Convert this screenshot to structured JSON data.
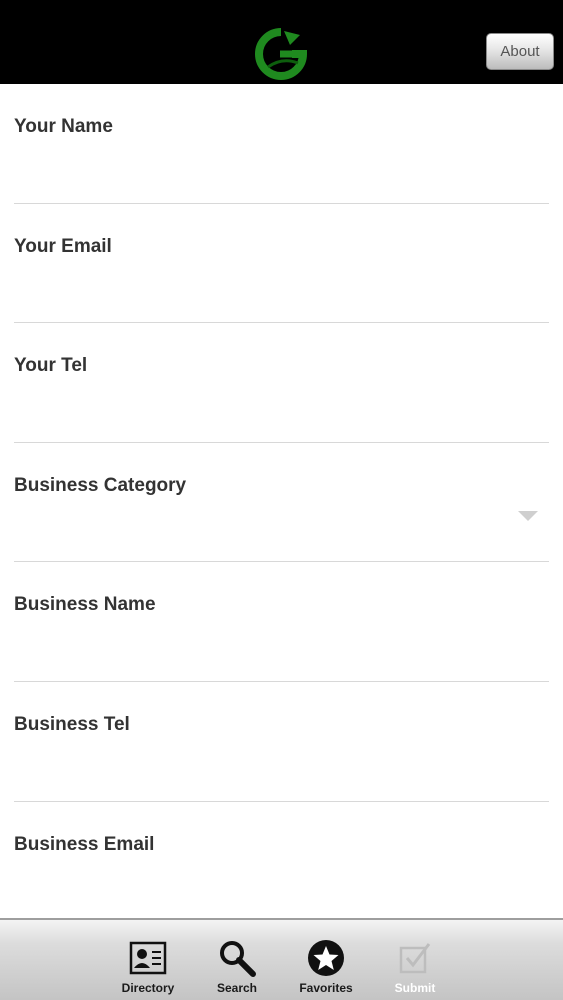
{
  "header": {
    "about_label": "About"
  },
  "form": {
    "fields": [
      {
        "label": "Your Name",
        "value": "",
        "type": "text"
      },
      {
        "label": "Your Email",
        "value": "",
        "type": "text"
      },
      {
        "label": "Your Tel",
        "value": "",
        "type": "text"
      },
      {
        "label": "Business Category",
        "value": "",
        "type": "select"
      },
      {
        "label": "Business Name",
        "value": "",
        "type": "text"
      },
      {
        "label": "Business Tel",
        "value": "",
        "type": "text"
      },
      {
        "label": "Business Email",
        "value": "",
        "type": "text"
      }
    ]
  },
  "tabbar": {
    "tabs": [
      {
        "label": "Directory",
        "icon": "contact-card-icon"
      },
      {
        "label": "Search",
        "icon": "search-icon"
      },
      {
        "label": "Favorites",
        "icon": "star-icon"
      },
      {
        "label": "Submit",
        "icon": "checkbox-icon",
        "active": true
      }
    ]
  },
  "colors": {
    "logo_green": "#1f8a1f",
    "header_bg": "#000000",
    "label_text": "#333333"
  }
}
